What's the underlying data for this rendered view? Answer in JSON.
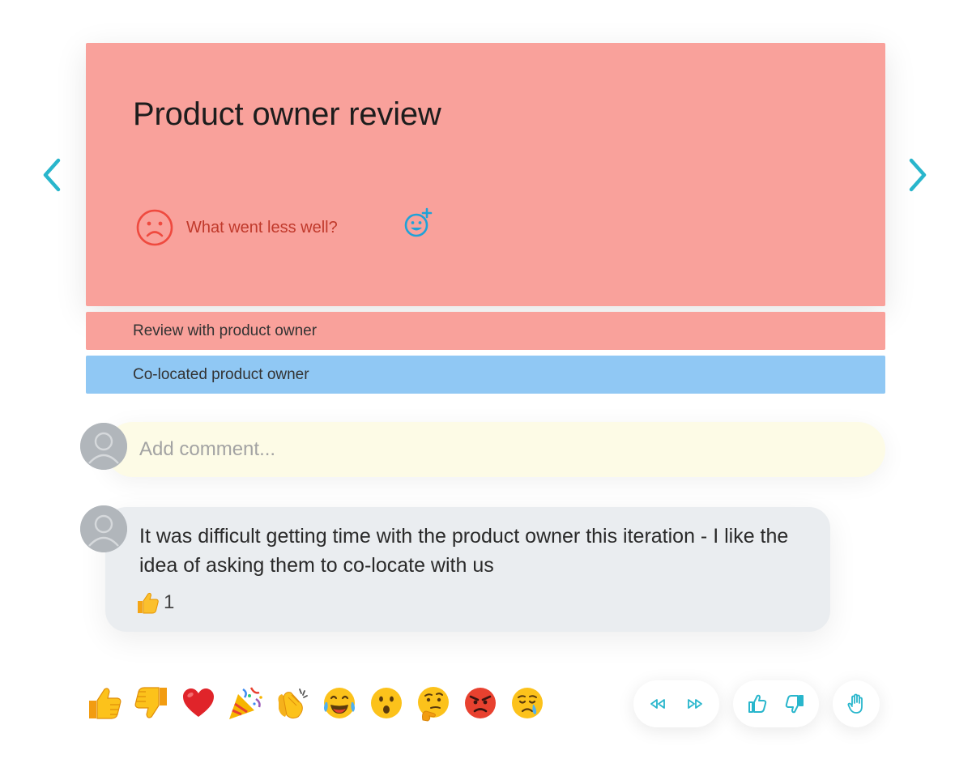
{
  "card": {
    "title": "Product owner review",
    "category_icon": "sad-face-icon",
    "category_label": "What went less well?",
    "add_reaction_icon": "add-emoji-icon",
    "background": "#f9a19b"
  },
  "navigation": {
    "previous_icon": "chevron-left-icon",
    "next_icon": "chevron-right-icon",
    "accent": "#29b6cc"
  },
  "linked_items": [
    {
      "label": "Review with product owner",
      "color": "#f9a19b"
    },
    {
      "label": "Co-located product owner",
      "color": "#90c8f4"
    }
  ],
  "comment_input": {
    "placeholder": "Add comment..."
  },
  "comments": [
    {
      "text": "It was difficult getting time with the product owner this iteration - I like the idea of asking them to co-locate with us",
      "reaction_icon": "thumbs-up-icon",
      "reaction_count": "1"
    }
  ],
  "reaction_bar": [
    "thumbs-up-icon",
    "thumbs-down-icon",
    "heart-icon",
    "party-popper-icon",
    "clapping-hands-icon",
    "tears-of-joy-icon",
    "surprised-face-icon",
    "thinking-face-icon",
    "angry-face-icon",
    "crying-face-icon"
  ],
  "controls": {
    "rewind_icon": "rewind-icon",
    "fast_forward_icon": "fast-forward-icon",
    "vote_up_icon": "vote-up-icon",
    "vote_down_icon": "vote-down-icon",
    "raise_hand_icon": "raise-hand-icon"
  }
}
